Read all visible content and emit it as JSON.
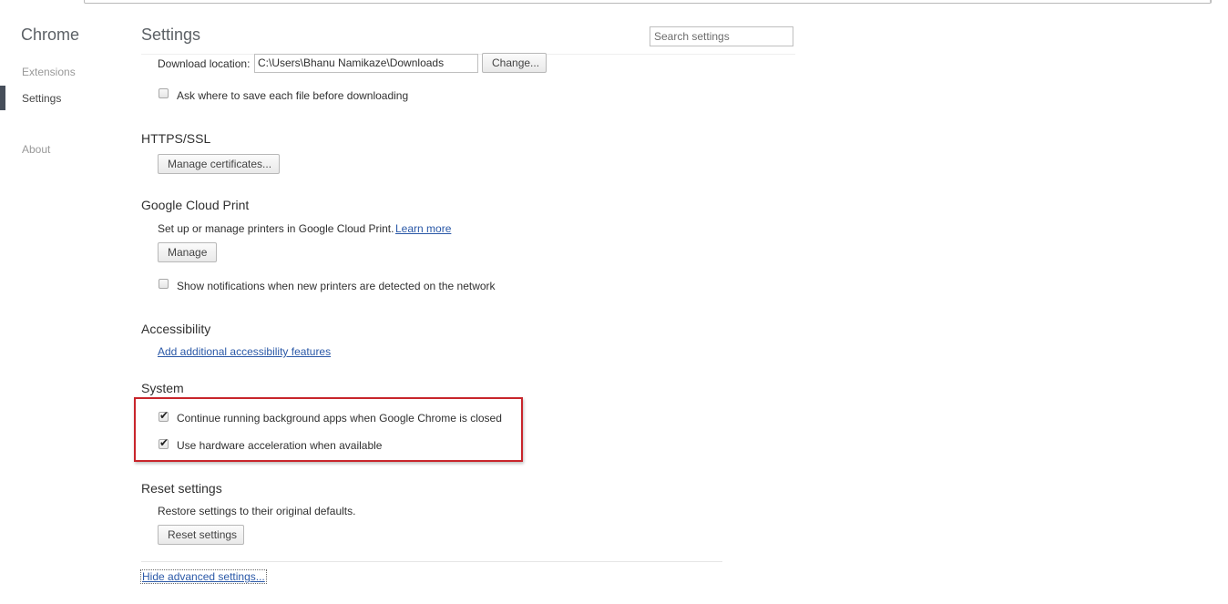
{
  "sidebar": {
    "brand": "Chrome",
    "items": [
      {
        "label": "Extensions"
      },
      {
        "label": "Settings"
      },
      {
        "label": "About"
      }
    ],
    "selected": "Settings"
  },
  "header": {
    "title": "Settings",
    "search_placeholder": "Search settings"
  },
  "downloads": {
    "location_label": "Download location:",
    "location_value": "C:\\Users\\Bhanu Namikaze\\Downloads",
    "change_button": "Change...",
    "ask_where_label": "Ask where to save each file before downloading",
    "ask_where_checked": false
  },
  "https_ssl": {
    "title": "HTTPS/SSL",
    "manage_certificates_button": "Manage certificates..."
  },
  "cloud_print": {
    "title": "Google Cloud Print",
    "description": "Set up or manage printers in Google Cloud Print.",
    "learn_more": "Learn more",
    "manage_button": "Manage",
    "notifications_label": "Show notifications when new printers are detected on the network",
    "notifications_checked": false
  },
  "accessibility": {
    "title": "Accessibility",
    "add_features_link": "Add additional accessibility features"
  },
  "system": {
    "title": "System",
    "background_apps_label": "Continue running background apps when Google Chrome is closed",
    "background_apps_checked": true,
    "hardware_accel_label": "Use hardware acceleration when available",
    "hardware_accel_checked": true
  },
  "reset": {
    "title": "Reset settings",
    "description": "Restore settings to their original defaults.",
    "reset_button": "Reset settings"
  },
  "footer": {
    "hide_advanced_link": "Hide advanced settings..."
  },
  "colors": {
    "highlight_border": "#c8252b",
    "link": "#2a58a7",
    "selected_bar": "#464e5a"
  },
  "icons": {
    "check": "check-icon"
  }
}
